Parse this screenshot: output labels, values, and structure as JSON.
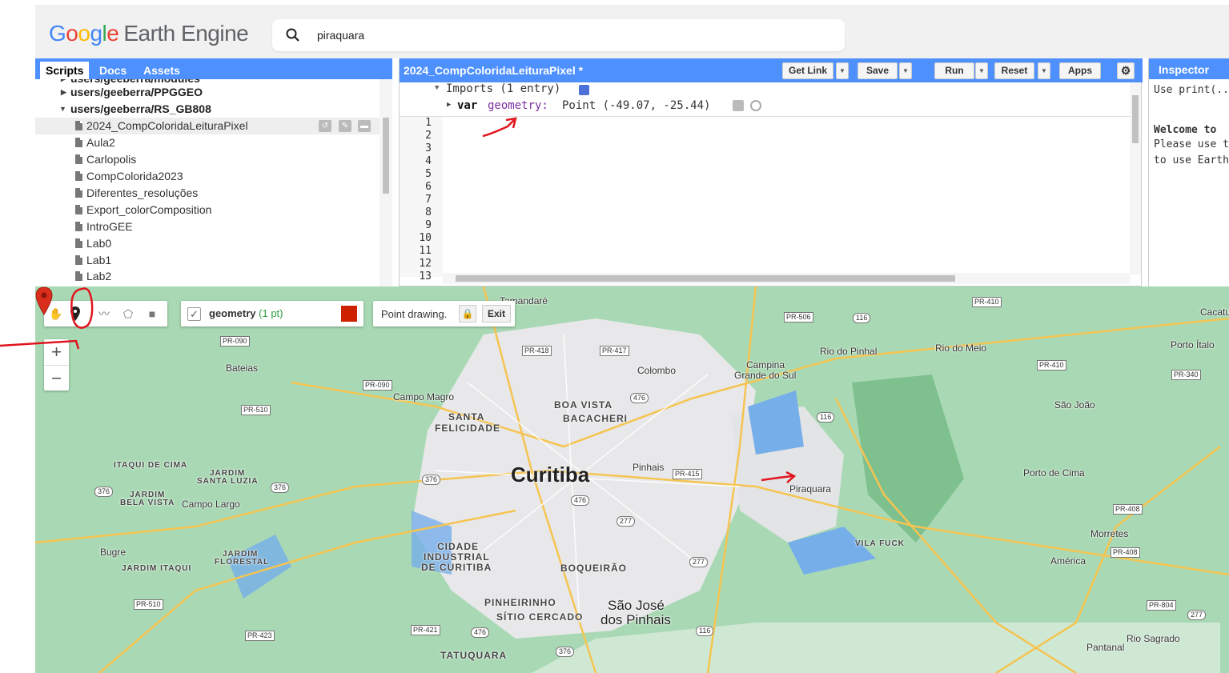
{
  "header": {
    "logo_google": [
      "G",
      "o",
      "o",
      "g",
      "l",
      "e"
    ],
    "logo_product": "Earth Engine",
    "search_value": "piraquara"
  },
  "left_panel": {
    "tabs": [
      "Scripts",
      "Docs",
      "Assets"
    ],
    "tree": [
      {
        "label": "users/geeberra/modules",
        "type": "folder",
        "expanded": false
      },
      {
        "label": "users/geeberra/PPGGEO",
        "type": "folder",
        "expanded": false
      },
      {
        "label": "users/geeberra/RS_GB808",
        "type": "folder",
        "expanded": true
      },
      {
        "label": "2024_CompColoridaLeituraPixel",
        "type": "file",
        "selected": true
      },
      {
        "label": "Aula2",
        "type": "file"
      },
      {
        "label": "Carlopolis",
        "type": "file"
      },
      {
        "label": "CompColorida2023",
        "type": "file"
      },
      {
        "label": "Diferentes_resoluções",
        "type": "file"
      },
      {
        "label": "Export_colorComposition",
        "type": "file"
      },
      {
        "label": "IntroGEE",
        "type": "file"
      },
      {
        "label": "Lab0",
        "type": "file"
      },
      {
        "label": "Lab1",
        "type": "file"
      },
      {
        "label": "Lab2",
        "type": "file"
      }
    ]
  },
  "code_editor": {
    "script_title": "2024_CompColoridaLeituraPixel *",
    "buttons": {
      "get_link": "Get Link",
      "save": "Save",
      "run": "Run",
      "reset": "Reset",
      "apps": "Apps"
    },
    "imports_label": "Imports (1 entry)",
    "import_var_keyword": "var",
    "import_var_name": "geometry:",
    "import_var_value": "Point (-49.07, -25.44)",
    "line_numbers": [
      "1",
      "2",
      "3",
      "4",
      "5",
      "6",
      "7",
      "8",
      "9",
      "10",
      "11",
      "12",
      "13"
    ]
  },
  "inspector": {
    "tab_label": "Inspector",
    "line1": "Use print(...",
    "welcome_lines": [
      "Welcome to",
      "Please use t",
      "to use Earth"
    ]
  },
  "map": {
    "toolbar_tools": [
      "pan-hand-icon",
      "point-marker-icon",
      "line-icon",
      "polygon-icon",
      "rectangle-icon"
    ],
    "layer": {
      "name": "geometry",
      "count": "(1 pt)",
      "color": "#cc2200"
    },
    "drawing_label": "Point drawing.",
    "exit_label": "Exit",
    "zoom_in": "+",
    "zoom_out": "−",
    "labels": {
      "curitiba": "Curitiba",
      "sao_jose": "São José",
      "dos_pinhais": "dos Pinhais",
      "piraquara": "Piraquara",
      "tamandare": "Tamandaré",
      "bateias": "Bateias",
      "colombo": "Colombo",
      "campina": "Campina",
      "grande_do_sul": "Grande do Sul",
      "rio_do_pinhal": "Rio do Pinhal",
      "rio_do_meio": "Rio do Meio",
      "porto_italo": "Porto Ítalo",
      "cacatu": "Cacatu",
      "sao_joao": "São João",
      "porto_de_cima": "Porto de Cima",
      "morretes": "Morretes",
      "america": "América",
      "pantanal": "Pantanal",
      "rio_sagrado": "Rio Sagrado",
      "campo_magro": "Campo Magro",
      "boa_vista": "BOA VISTA",
      "bacacheri": "BACACHERI",
      "santa": "SANTA",
      "felicidade": "FELICIDADE",
      "pinhais": "Pinhais",
      "itaqui_de_cima": "ITAQUI DE CIMA",
      "jardim": "JARDIM",
      "santa_luzia": "SANTA LUZIA",
      "bela_vista": "BELA VISTA",
      "campo_largo": "Campo Largo",
      "bugre": "Bugre",
      "jardim_itaqui": "JARDIM ITAQUI",
      "floresta": "FLORESTAL",
      "cidade": "CIDADE",
      "industrial": "INDUSTRIAL",
      "de_curitiba": "DE CURITIBA",
      "boqueirao": "BOQUEIRÃO",
      "pinheirinho": "PINHEIRINHO",
      "sitio_cercado": "SÍTIO CERCADO",
      "tatuquara": "TATUQUARA",
      "vila_fuck": "VILA FUCK"
    },
    "shields": [
      "PR-090",
      "PR-090",
      "PR-510",
      "PR-418",
      "PR-417",
      "PR-506",
      "PR-410",
      "PR-410",
      "PR-340",
      "PR-415",
      "PR-408",
      "PR-408",
      "PR-804",
      "PR-510",
      "PR-423",
      "PR-421",
      "116",
      "116",
      "116",
      "476",
      "476",
      "476",
      "376",
      "376",
      "376",
      "376",
      "277",
      "277",
      "277"
    ]
  }
}
